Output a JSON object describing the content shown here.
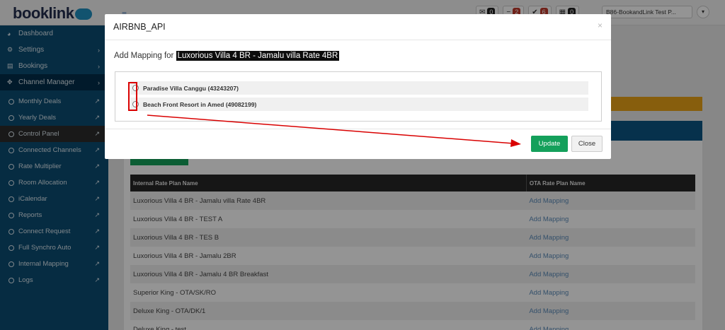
{
  "app": {
    "logo_text": "booklink",
    "badges": [
      {
        "icon": "envelope-icon",
        "count": "0",
        "color": "#222222"
      },
      {
        "icon": "minus-icon",
        "count": "2",
        "color": "#c0392b"
      },
      {
        "icon": "check-icon",
        "count": "6",
        "color": "#c0392b"
      },
      {
        "icon": "calendar-icon",
        "count": "0",
        "color": "#222222"
      }
    ],
    "property_selector": "B86-BookandLink Test P..."
  },
  "sidebar": {
    "groups": [
      {
        "label": "Dashboard",
        "icon": "dashboard-icon",
        "has_arrow": false
      },
      {
        "label": "Settings",
        "icon": "gear-icon",
        "has_arrow": true
      },
      {
        "label": "Bookings",
        "icon": "list-icon",
        "has_arrow": true
      },
      {
        "label": "Channel Manager",
        "icon": "move-icon",
        "has_arrow": true
      }
    ],
    "sub_items": [
      "Monthly Deals",
      "Yearly Deals",
      "Control Panel",
      "Connected Channels",
      "Rate Multiplier",
      "Room Allocation",
      "iCalendar",
      "Reports",
      "Connect Request",
      "Full Synchro Auto",
      "Internal Mapping",
      "Logs"
    ],
    "active_sub": "Control Panel"
  },
  "table": {
    "headers": [
      "Internal Rate Plan Name",
      "OTA Rate Plan Name"
    ],
    "rows": [
      [
        "Luxorious Villa 4 BR - Jamalu villa Rate 4BR",
        "Add Mapping"
      ],
      [
        "Luxorious Villa 4 BR - TEST A",
        "Add Mapping"
      ],
      [
        "Luxorious Villa 4 BR - TES B",
        "Add Mapping"
      ],
      [
        "Luxorious Villa 4 BR - Jamalu 2BR",
        "Add Mapping"
      ],
      [
        "Luxorious Villa 4 BR - Jamalu 4 BR Breakfast",
        "Add Mapping"
      ],
      [
        "Superior King - OTA/SK/RO",
        "Add Mapping"
      ],
      [
        "Deluxe King - OTA/DK/1",
        "Add Mapping"
      ],
      [
        "Deluxe King - test",
        "Add Mapping"
      ]
    ]
  },
  "modal": {
    "title": "AIRBNB_API",
    "close_symbol": "×",
    "mapping_prefix": "Add Mapping for",
    "mapping_target": "Luxorious Villa 4 BR - Jamalu villa Rate 4BR",
    "options": [
      "Paradise Villa Canggu (43243207)",
      "Beach Front Resort in Amed (49082199)"
    ],
    "update_label": "Update",
    "close_label": "Close"
  },
  "colors": {
    "sidebar_bg": "#0b4d72",
    "update_btn": "#14a05b",
    "annotation_red": "#d90000"
  }
}
